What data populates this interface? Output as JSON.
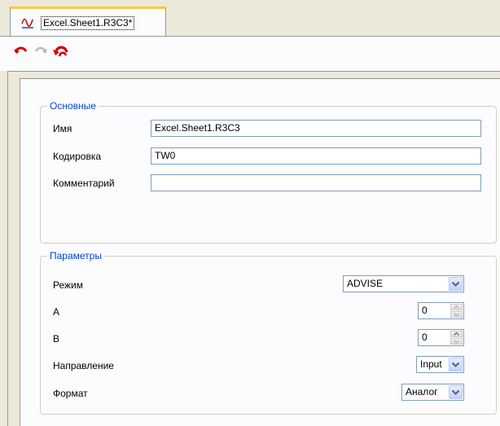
{
  "tab": {
    "title": "Excel.Sheet1.R3C3*",
    "icon": "signal-wave-icon"
  },
  "toolbar": {
    "buttons": [
      {
        "name": "undo",
        "icon": "undo-arrow-icon",
        "enabled": true
      },
      {
        "name": "redo",
        "icon": "redo-arrow-icon",
        "enabled": false
      },
      {
        "name": "undo-all",
        "icon": "undo-all-icon",
        "enabled": true
      }
    ]
  },
  "basic": {
    "title": "Основные",
    "name_label": "Имя",
    "name_value": "Excel.Sheet1.R3C3",
    "encoding_label": "Кодировка",
    "encoding_value": "TW0",
    "comment_label": "Комментарий",
    "comment_value": ""
  },
  "params": {
    "title": "Параметры",
    "mode_label": "Режим",
    "mode_value": "ADVISE",
    "a_label": "A",
    "a_value": "0",
    "b_label": "B",
    "b_value": "0",
    "direction_label": "Направление",
    "direction_value": "Input",
    "format_label": "Формат",
    "format_value": "Аналог"
  },
  "colors": {
    "group_title": "#0046d5",
    "tab_accent": "#ffc83c",
    "icon_red": "#d40000"
  }
}
